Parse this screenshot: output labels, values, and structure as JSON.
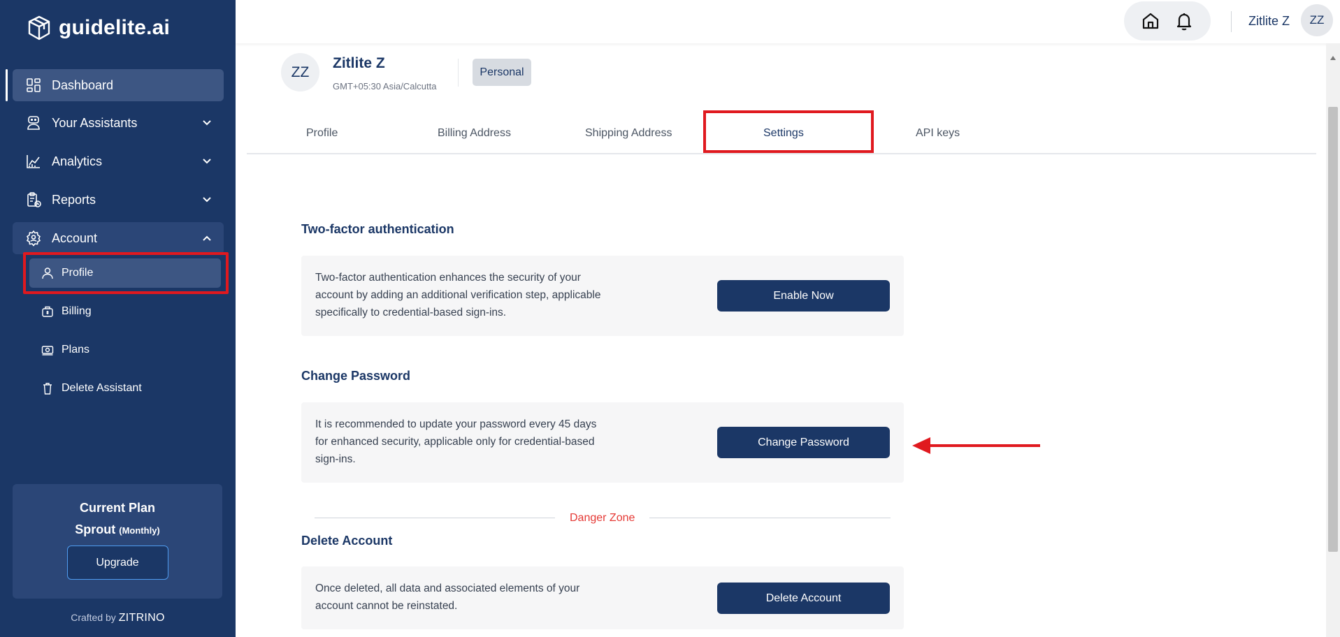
{
  "brand": {
    "name": "guidelite.ai"
  },
  "sidebar": {
    "items": [
      {
        "label": "Dashboard",
        "icon": "dashboard-icon"
      },
      {
        "label": "Your Assistants",
        "icon": "assistant-icon"
      },
      {
        "label": "Analytics",
        "icon": "chart-icon"
      },
      {
        "label": "Reports",
        "icon": "report-icon"
      },
      {
        "label": "Account",
        "icon": "account-gear-icon"
      }
    ],
    "account_sub": [
      {
        "label": "Profile",
        "icon": "user-icon"
      },
      {
        "label": "Billing",
        "icon": "billing-icon"
      },
      {
        "label": "Plans",
        "icon": "plans-icon"
      },
      {
        "label": "Delete Assistant",
        "icon": "trash-icon"
      }
    ],
    "plan": {
      "title": "Current Plan",
      "name": "Sprout",
      "period": "(Monthly)",
      "upgrade_label": "Upgrade"
    },
    "crafted_prefix": "Crafted by",
    "crafted_brand": "ZITRINO"
  },
  "topbar": {
    "user_name": "Zitlite Z",
    "avatar_initials": "ZZ"
  },
  "profile": {
    "initials": "ZZ",
    "name": "Zitlite Z",
    "timezone": "GMT+05:30 Asia/Calcutta",
    "badge": "Personal"
  },
  "tabs": [
    "Profile",
    "Billing Address",
    "Shipping Address",
    "Settings",
    "API keys"
  ],
  "active_tab": "Settings",
  "sections": {
    "two_factor": {
      "title": "Two-factor authentication",
      "text": "Two-factor authentication enhances the security of your account by adding an additional verification step, applicable specifically to credential-based sign-ins.",
      "button": "Enable Now"
    },
    "change_password": {
      "title": "Change Password",
      "text": "It is recommended to update your password every 45 days for enhanced security, applicable only for credential-based sign-ins.",
      "button": "Change Password"
    },
    "danger_zone": {
      "label": "Danger Zone"
    },
    "delete_account": {
      "title": "Delete Account",
      "text": "Once deleted, all data and associated elements of your account cannot be reinstated.",
      "button": "Delete Account"
    }
  },
  "colors": {
    "sidebar_bg": "#1b3766",
    "primary_button": "#1b3766",
    "highlight_red": "#e0191f",
    "danger_text": "#e53935"
  }
}
